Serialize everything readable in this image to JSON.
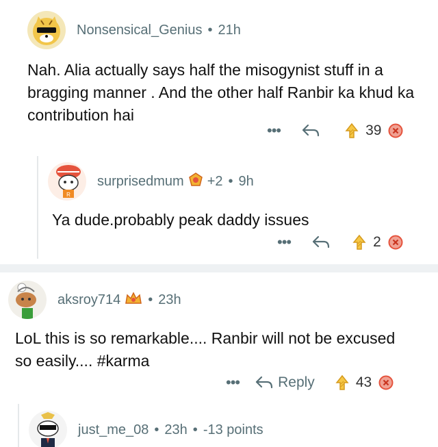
{
  "comments": [
    {
      "username": "Nonsensical_Genius",
      "time": "21h",
      "text": "Nah. Alia actually says half the misogynist stuff in a bragging manner . And the other half Ranbir ka khud ka contribution hai",
      "votes": "39",
      "reply_label": ""
    },
    {
      "username": "surprisedmum",
      "awards": "+2",
      "time": "9h",
      "text": "Ya dude.probably peak daddy issues",
      "votes": "2",
      "reply_label": ""
    },
    {
      "username": "aksroy714",
      "time": "23h",
      "text": "LoL this is so remarkable.... Ranbir will not be excused so easily.... #karma",
      "votes": "43",
      "reply_label": "Reply"
    },
    {
      "username": "just_me_08",
      "time": "23h",
      "points": "-13 points"
    }
  ],
  "icons": {
    "more": "more-icon",
    "reply": "reply-arrow-icon",
    "upvote": "upvote-icon",
    "downvote": "downvote-icon"
  },
  "colors": {
    "meta": "#576f76",
    "upvote": "#e8a93a",
    "downvote": "#e5533d",
    "divider": "#eef1f3"
  }
}
